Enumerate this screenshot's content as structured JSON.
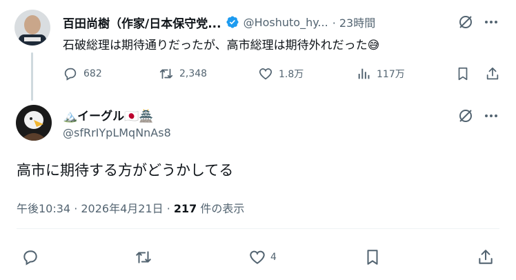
{
  "parent": {
    "name": "百田尚樹（作家/日本保守党...",
    "handle": "@Hoshuto_hy...",
    "time": "· 23時間",
    "text": "石破総理は期待通りだったが、高市総理は期待外れだった😅",
    "stats": {
      "replies": "682",
      "retweets": "2,348",
      "likes": "1.8万",
      "views": "117万"
    }
  },
  "reply": {
    "name": "🏔️イーグル🇯🇵🏯",
    "handle": "@sfRrIYpLMqNnAs8",
    "text": "高市に期待する方がどうかしてる",
    "timestamp": "午後10:34 · 2026年4月21日 · ",
    "views_count": "217",
    "views_label": " 件の表示",
    "stats": {
      "likes": "4"
    }
  },
  "colors": {
    "accent": "#1d9bf0",
    "secondary_text": "#536471",
    "primary_text": "#0f1419",
    "thread_line": "#cfd9de"
  },
  "icons": [
    "grok-icon",
    "more-icon",
    "reply-icon",
    "retweet-icon",
    "like-icon",
    "views-icon",
    "bookmark-icon",
    "share-icon",
    "verified-badge-icon"
  ]
}
